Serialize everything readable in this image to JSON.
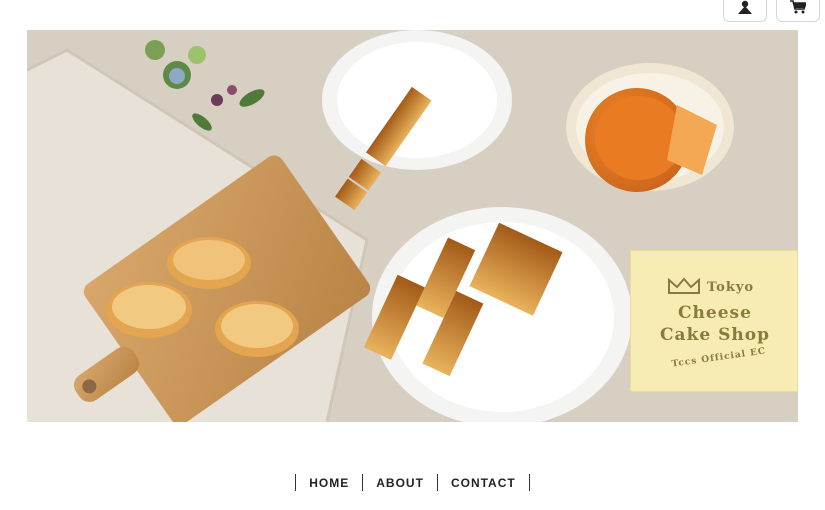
{
  "header": {
    "user_icon": "user-icon",
    "cart_icon": "cart-icon"
  },
  "hero": {
    "logo": {
      "line1": "Tokyo",
      "line2": "Cheese",
      "line3": "Cake Shop",
      "line4": "Tccs Official EC"
    }
  },
  "nav": {
    "items": [
      {
        "label": "HOME"
      },
      {
        "label": "ABOUT"
      },
      {
        "label": "CONTACT"
      }
    ]
  },
  "colors": {
    "logo_bg": "#f6ecb4",
    "logo_text": "#8a7a3c",
    "tablecloth": "#d8cfc3"
  }
}
